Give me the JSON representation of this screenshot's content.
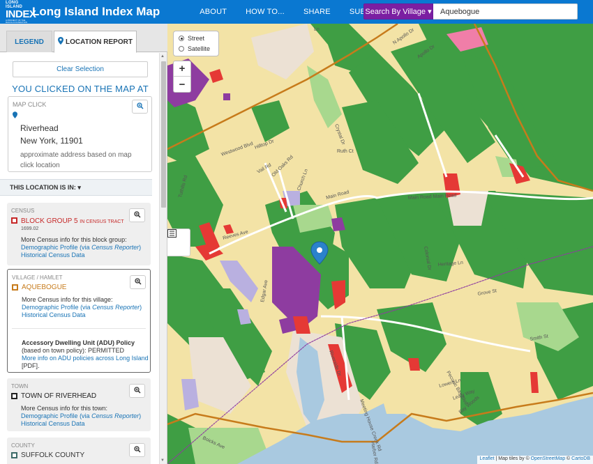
{
  "header": {
    "logo_line1": "LONG ISLAND",
    "logo_line2": "INDEX",
    "logo_line3": "A PROJECT OF THE RAUCH FOUNDATION",
    "title": "Long Island Index Map",
    "nav": [
      "ABOUT",
      "HOW TO...",
      "SHARE",
      "SUBSCRIBE"
    ],
    "search_button": "Search By Village ▾",
    "search_value": "Aquebogue"
  },
  "sidebar": {
    "tabs": {
      "legend": "LEGEND",
      "location": "LOCATION REPORT"
    },
    "clear_selection": "Clear Selection",
    "clicked_title": "YOU CLICKED ON THE MAP AT",
    "map_click": {
      "label": "MAP CLICK",
      "city": "Riverhead",
      "state_zip": "New York, 11901",
      "note": "approximate address based on map click location"
    },
    "location_header": "THIS LOCATION IS IN: ▾",
    "census": {
      "category": "CENSUS",
      "name": "BLOCK GROUP 5",
      "name_suffix": "IN CENSUS TRACT",
      "tract": "1699.02",
      "more_info": "More Census info for this block group:",
      "link1": "Demographic Profile",
      "link1_via": "(via",
      "link1_source": "Census Reporter",
      "link1_close": ")",
      "link2": "Historical Census Data"
    },
    "village": {
      "category": "VILLAGE / HAMLET",
      "name": "AQUEBOGUE",
      "more_info": "More Census info for this village:",
      "link1": "Demographic Profile",
      "link1_via": "(via",
      "link1_source": "Census Reporter",
      "link1_close": ")",
      "link2": "Historical Census Data",
      "adu_title": "Accessory Dwelling Unit (ADU) Policy",
      "adu_status": "(based on town policy): PERMITTED",
      "adu_link": "More info on ADU policies across Long Island",
      "adu_pdf": "[PDF]."
    },
    "town": {
      "category": "TOWN",
      "name": "TOWN OF RIVERHEAD",
      "more_info": "More Census info for this town:",
      "link1": "Demographic Profile",
      "link1_via": "(via",
      "link1_source": "Census Reporter",
      "link1_close": ")",
      "link2": "Historical Census Data"
    },
    "county": {
      "category": "COUNTY",
      "name": "SUFFOLK COUNTY"
    }
  },
  "map": {
    "layers": {
      "street": "Street",
      "satellite": "Satellite"
    },
    "zoom_in": "+",
    "zoom_out": "−",
    "streets": [
      "Westwood Blvd",
      "Hilltop Dr",
      "Old Oaks Rd",
      "Church Ln",
      "Main Road",
      "Main Road Main Road",
      "Colonial Dr",
      "Heritage Ln",
      "Edgar Ave",
      "Meeting House Creek Rd",
      "Riverside Dr",
      "Peconic Bay Blvd",
      "Lowers Ln",
      "Leafy Way",
      "Bay Woods",
      "Grove St",
      "Boicks Ave",
      "N Apollo Dr",
      "Apollo Dr",
      "Vail Rd",
      "Ln",
      "Crystal Dr",
      "Reeves Ave",
      "Tuthills Rd",
      "Ruth Ct",
      "Harbor Rd",
      "Smith St"
    ],
    "attribution": {
      "leaflet": "Leaflet",
      "tiles": " | Map tiles by © ",
      "osm": "OpenStreetMap",
      "sep": " © ",
      "carto": "CartoDB"
    },
    "colors": {
      "residential": "#f3e3a6",
      "farmland": "#3f9e44",
      "commercial": "#d9c6e8",
      "red": "#e53935",
      "purple": "#8e3ca0",
      "boundary": "#c77b1b",
      "water": "#a9c9e0"
    }
  }
}
